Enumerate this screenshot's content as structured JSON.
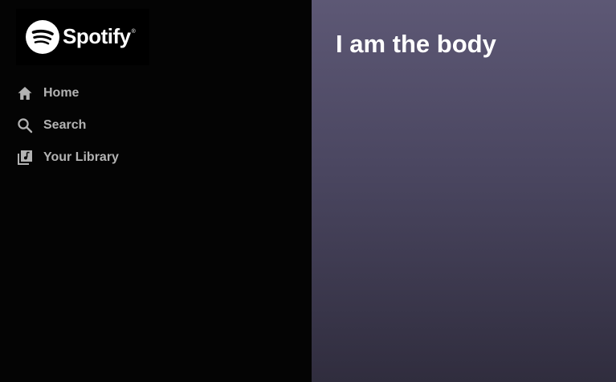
{
  "sidebar": {
    "logo": {
      "wordmark": "Spotify",
      "trademark": "®",
      "icon": "spotify-logo-icon"
    },
    "items": [
      {
        "label": "Home",
        "icon": "home-icon"
      },
      {
        "label": "Search",
        "icon": "search-icon"
      },
      {
        "label": "Your Library",
        "icon": "library-icon"
      }
    ]
  },
  "main": {
    "title": "I am the body"
  },
  "colors": {
    "sidebar_bg": "#040404",
    "logo_bg": "#000000",
    "nav_text": "#b3b3b3",
    "body_gradient_top": "#5d5875",
    "body_gradient_bottom": "#302d3e",
    "title_text": "#ffffff"
  }
}
